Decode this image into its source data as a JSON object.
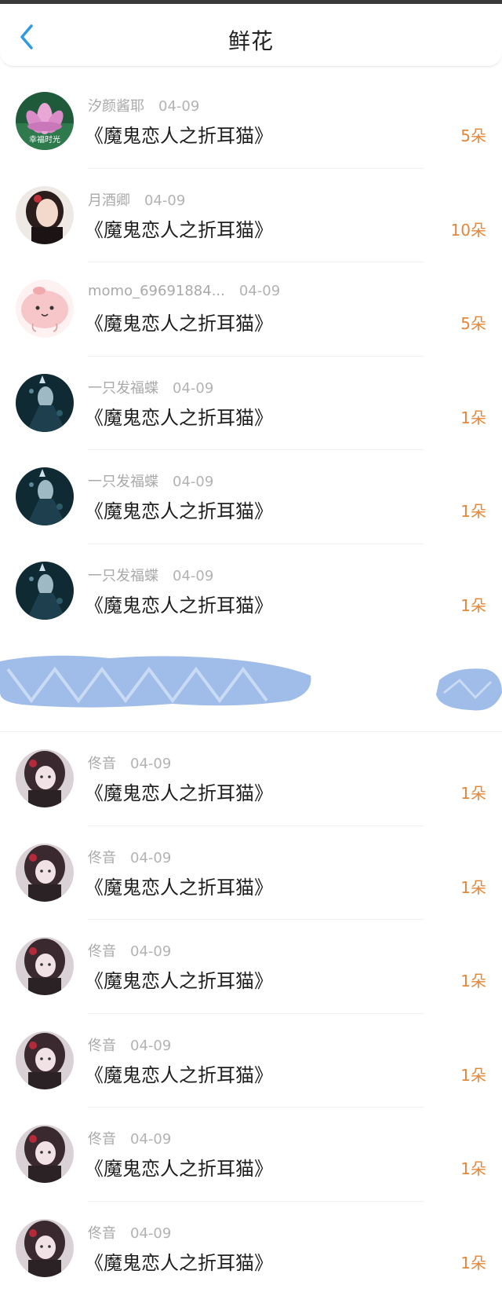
{
  "header": {
    "title": "鲜花",
    "back_icon": "chevron-left-icon"
  },
  "colors": {
    "accent": "#e4873a",
    "back": "#2f9ae0",
    "redaction": "#9fbde8"
  },
  "rows": [
    {
      "user": "汐颜酱耶",
      "date": "04-09",
      "book": "《魔鬼恋人之折耳猫》",
      "count": "5朵",
      "avatar": "lotus-avatar",
      "avatar_text": "幸福时光"
    },
    {
      "user": "月酒卿",
      "date": "04-09",
      "book": "《魔鬼恋人之折耳猫》",
      "count": "10朵",
      "avatar": "portrait-girl-avatar"
    },
    {
      "user": "momo_69691884...",
      "date": "04-09",
      "book": "《魔鬼恋人之折耳猫》",
      "count": "5朵",
      "avatar": "pink-cartoon-avatar"
    },
    {
      "user": "一只发福蝶",
      "date": "04-09",
      "book": "《魔鬼恋人之折耳猫》",
      "count": "1朵",
      "avatar": "dark-anime-avatar"
    },
    {
      "user": "一只发福蝶",
      "date": "04-09",
      "book": "《魔鬼恋人之折耳猫》",
      "count": "1朵",
      "avatar": "dark-anime-avatar"
    },
    {
      "user": "一只发福蝶",
      "date": "04-09",
      "book": "《魔鬼恋人之折耳猫》",
      "count": "1朵",
      "avatar": "dark-anime-avatar"
    }
  ],
  "rows_after": [
    {
      "user": "佟音",
      "date": "04-09",
      "book": "《魔鬼恋人之折耳猫》",
      "count": "1朵",
      "avatar": "anime-girl-avatar"
    },
    {
      "user": "佟音",
      "date": "04-09",
      "book": "《魔鬼恋人之折耳猫》",
      "count": "1朵",
      "avatar": "anime-girl-avatar"
    },
    {
      "user": "佟音",
      "date": "04-09",
      "book": "《魔鬼恋人之折耳猫》",
      "count": "1朵",
      "avatar": "anime-girl-avatar"
    },
    {
      "user": "佟音",
      "date": "04-09",
      "book": "《魔鬼恋人之折耳猫》",
      "count": "1朵",
      "avatar": "anime-girl-avatar"
    },
    {
      "user": "佟音",
      "date": "04-09",
      "book": "《魔鬼恋人之折耳猫》",
      "count": "1朵",
      "avatar": "anime-girl-avatar"
    },
    {
      "user": "佟音",
      "date": "04-09",
      "book": "《魔鬼恋人之折耳猫》",
      "count": "1朵",
      "avatar": "anime-girl-avatar"
    }
  ]
}
